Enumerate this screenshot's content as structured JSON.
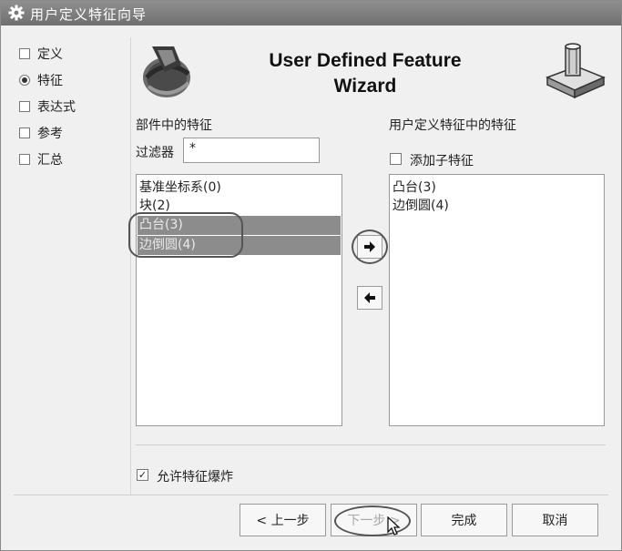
{
  "window": {
    "title": "用户定义特征向导"
  },
  "header": {
    "title_line1": "User Defined Feature",
    "title_line2": "Wizard"
  },
  "steps": [
    {
      "label": "定义",
      "state": "unchecked"
    },
    {
      "label": "特征",
      "state": "current"
    },
    {
      "label": "表达式",
      "state": "unchecked"
    },
    {
      "label": "参考",
      "state": "unchecked"
    },
    {
      "label": "汇总",
      "state": "unchecked"
    }
  ],
  "left_panel": {
    "heading": "部件中的特征",
    "filter_label": "过滤器",
    "filter_value": "*",
    "items": [
      "基准坐标系(0)",
      "块(2)",
      "凸台(3)",
      "边倒圆(4)"
    ],
    "selected": [
      2,
      3
    ]
  },
  "right_panel": {
    "heading": "用户定义特征中的特征",
    "add_child_label": "添加子特征",
    "add_child_checked": false,
    "items": [
      "凸台(3)",
      "边倒圆(4)"
    ]
  },
  "move_buttons": {
    "add_icon": "arrow-right-icon",
    "remove_icon": "arrow-left-icon"
  },
  "allow_explode": {
    "label": "允许特征爆炸",
    "checked": true
  },
  "buttons": {
    "back": "< 上一步",
    "next": "下一步 >",
    "finish": "完成",
    "cancel": "取消"
  },
  "colors": {
    "titlebar": "#7d7d7d",
    "selection": "#8c8c8c"
  }
}
